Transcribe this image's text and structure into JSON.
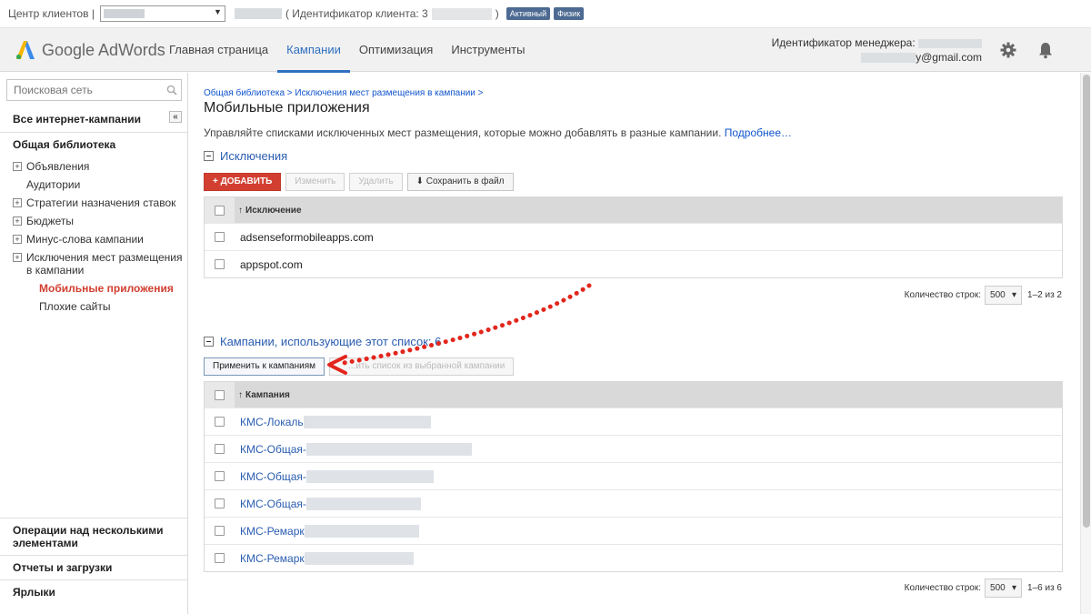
{
  "ccbar": {
    "label": "Центр клиентов |",
    "client_id_label": "( Идентификатор клиента: 3",
    "client_id_suffix": ")",
    "badges": [
      "Активный",
      "Физик"
    ]
  },
  "header": {
    "logo_text": "Google AdWords",
    "nav": [
      "Главная страница",
      "Кампании",
      "Оптимизация",
      "Инструменты"
    ],
    "active_tab": "Кампании",
    "manager_label": "Идентификатор менеджера:",
    "email": "y@gmail.com",
    "icons": [
      "gear-icon",
      "bell-icon"
    ]
  },
  "sidebar": {
    "search_placeholder": "Поисковая сеть",
    "all_campaigns": "Все интернет-кампании",
    "collapse": "«",
    "library": "Общая библиотека",
    "items": [
      {
        "label": "Объявления",
        "expandable": true
      },
      {
        "label": "Аудитории",
        "expandable": false
      },
      {
        "label": "Стратегии назначения ставок",
        "expandable": true
      },
      {
        "label": "Бюджеты",
        "expandable": true
      },
      {
        "label": "Минус-слова кампании",
        "expandable": true
      },
      {
        "label": "Исключения мест размещения в кампании",
        "expandable": true
      },
      {
        "label": "Мобильные приложения",
        "sub": true,
        "current": true
      },
      {
        "label": "Плохие сайты",
        "sub": true
      }
    ],
    "bottom": [
      "Операции над несколькими элементами",
      "Отчеты и загрузки",
      "Ярлыки"
    ]
  },
  "main": {
    "breadcrumb": "Общая библиотека > Исключения мест размещения в кампании >",
    "title": "Мобильные приложения",
    "description": "Управляйте списками исключенных мест размещения, которые можно добавлять в разные кампании.",
    "more_link": "Подробнее…",
    "exclusions": {
      "heading": "Исключения",
      "buttons": {
        "add": "ДОБАВИТЬ",
        "edit": "Изменить",
        "delete": "Удалить",
        "save": "Сохранить в файл"
      },
      "column": "Исключение",
      "rows": [
        "adsenseformobileapps.com",
        "appspot.com"
      ],
      "rows_label": "Количество строк:",
      "rows_value": "500",
      "range": "1–2 из 2"
    },
    "campaigns": {
      "heading": "Кампании, использующие этот список: 6",
      "apply_button": "Применить к кампаниям",
      "remove_button": "...ить список из выбранной кампании",
      "column": "Кампания",
      "rows": [
        "КМС-Локаль",
        "КМС-Общая-",
        "КМС-Общая-",
        "КМС-Общая-",
        "КМС-Ремарк",
        "КМС-Ремарк"
      ],
      "rows_label": "Количество строк:",
      "rows_value": "500",
      "range": "1–6 из 6"
    }
  },
  "colors": {
    "accent": "#2f6fc0",
    "red": "#d23f31",
    "link": "#1155cc",
    "badge": "#4d6a92"
  }
}
